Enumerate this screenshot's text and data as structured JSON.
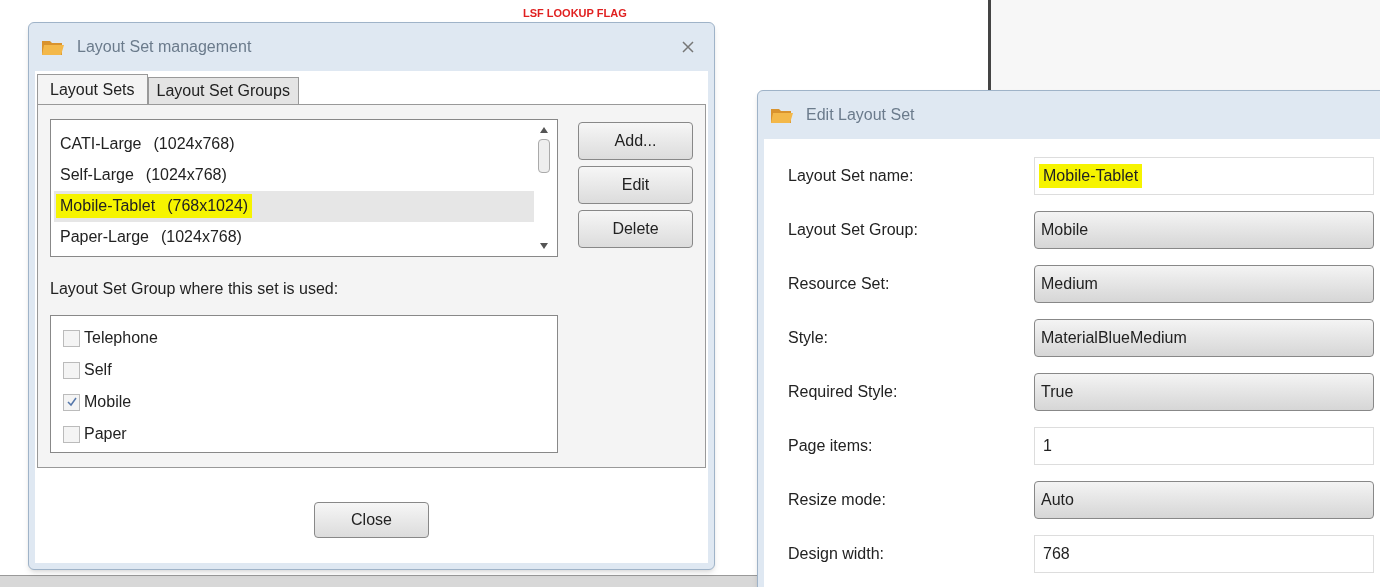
{
  "background": {
    "annotation": "LSF LOOKUP FLAG"
  },
  "layout_set_management": {
    "title": "Layout Set management",
    "tabs": [
      {
        "label": "Layout Sets",
        "selected": true
      },
      {
        "label": "Layout Set Groups",
        "selected": false
      }
    ],
    "layout_sets": [
      {
        "name": "CATI-Large",
        "size": "(1024x768)",
        "selected": false,
        "highlighted": false
      },
      {
        "name": "Self-Large",
        "size": "(1024x768)",
        "selected": false,
        "highlighted": false
      },
      {
        "name": "Mobile-Tablet",
        "size": "(768x1024)",
        "selected": true,
        "highlighted": true
      },
      {
        "name": "Paper-Large",
        "size": "(1024x768)",
        "selected": false,
        "highlighted": false
      }
    ],
    "buttons": [
      "Add...",
      "Edit",
      "Delete"
    ],
    "groups_label": "Layout Set Group where this set is used:",
    "groups": [
      {
        "label": "Telephone",
        "checked": false
      },
      {
        "label": "Self",
        "checked": false
      },
      {
        "label": "Mobile",
        "checked": true
      },
      {
        "label": "Paper",
        "checked": false
      }
    ],
    "close_button": "Close"
  },
  "edit_layout_set": {
    "title": "Edit Layout Set",
    "fields": [
      {
        "label": "Layout Set name:",
        "kind": "text",
        "value": "Mobile-Tablet",
        "highlighted": true
      },
      {
        "label": "Layout Set Group:",
        "kind": "dropdown",
        "value": "Mobile",
        "highlighted": false
      },
      {
        "label": "Resource Set:",
        "kind": "dropdown",
        "value": "Medium",
        "highlighted": false
      },
      {
        "label": "Style:",
        "kind": "dropdown",
        "value": "MaterialBlueMedium",
        "highlighted": false
      },
      {
        "label": "Required Style:",
        "kind": "dropdown",
        "value": "True",
        "highlighted": false
      },
      {
        "label": "Page items:",
        "kind": "text",
        "value": "1",
        "highlighted": false
      },
      {
        "label": "Resize mode:",
        "kind": "dropdown",
        "value": "Auto",
        "highlighted": false
      },
      {
        "label": "Design width:",
        "kind": "text",
        "value": "768",
        "highlighted": false
      }
    ]
  }
}
